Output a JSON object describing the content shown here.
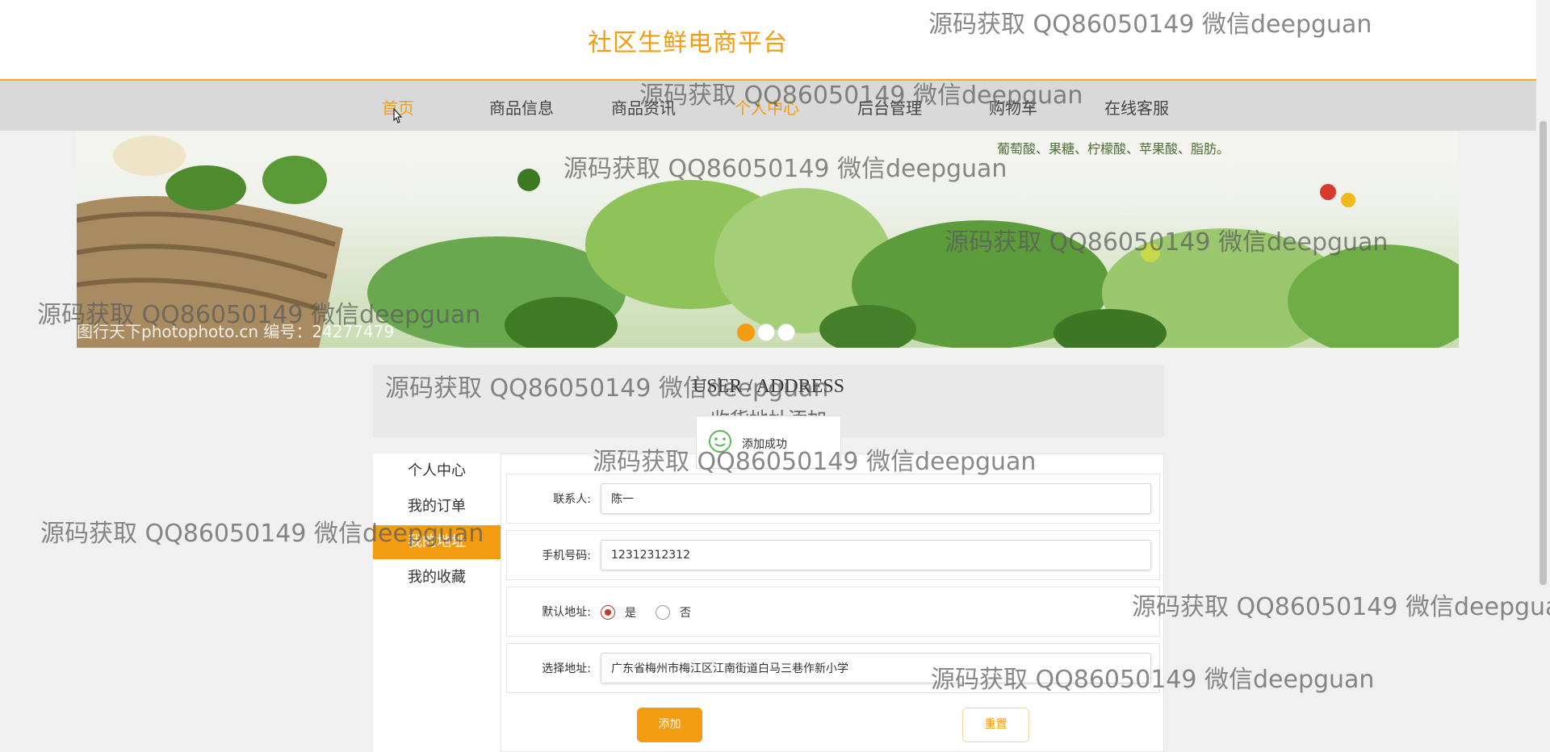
{
  "site": {
    "title": "社区生鲜电商平台"
  },
  "nav": {
    "items": [
      {
        "label": "首页"
      },
      {
        "label": "商品信息"
      },
      {
        "label": "商品资讯"
      },
      {
        "label": "个人中心"
      },
      {
        "label": "后台管理"
      },
      {
        "label": "购物车"
      },
      {
        "label": "在线客服"
      }
    ],
    "active_colors": {
      "accent": "#f39c12"
    }
  },
  "banner": {
    "caption": "葡萄酸、果糖、柠檬酸、苹果酸、脂肪。",
    "credit": "图行天下photophoto.cn  编号：24277479",
    "slides": 3,
    "active_slide": 1
  },
  "section": {
    "heading_en": "USER / ADDRESS",
    "heading_cn": "收货地址添加"
  },
  "toast": {
    "message": "添加成功"
  },
  "sidebar": {
    "items": [
      {
        "label": "个人中心"
      },
      {
        "label": "我的订单"
      },
      {
        "label": "我的地址"
      },
      {
        "label": "我的收藏"
      }
    ],
    "active_index": 2
  },
  "form": {
    "contact": {
      "label": "联系人:",
      "value": "陈一"
    },
    "phone": {
      "label": "手机号码:",
      "value": "12312312312"
    },
    "default": {
      "label": "默认地址:",
      "yes": "是",
      "no": "否",
      "selected": "是"
    },
    "address": {
      "label": "选择地址:",
      "value": "广东省梅州市梅江区江南街道白马三巷作新小学"
    },
    "submit_label": "添加",
    "reset_label": "重置"
  },
  "watermark": {
    "text": "源码获取 QQ86050149 微信deepguan"
  }
}
